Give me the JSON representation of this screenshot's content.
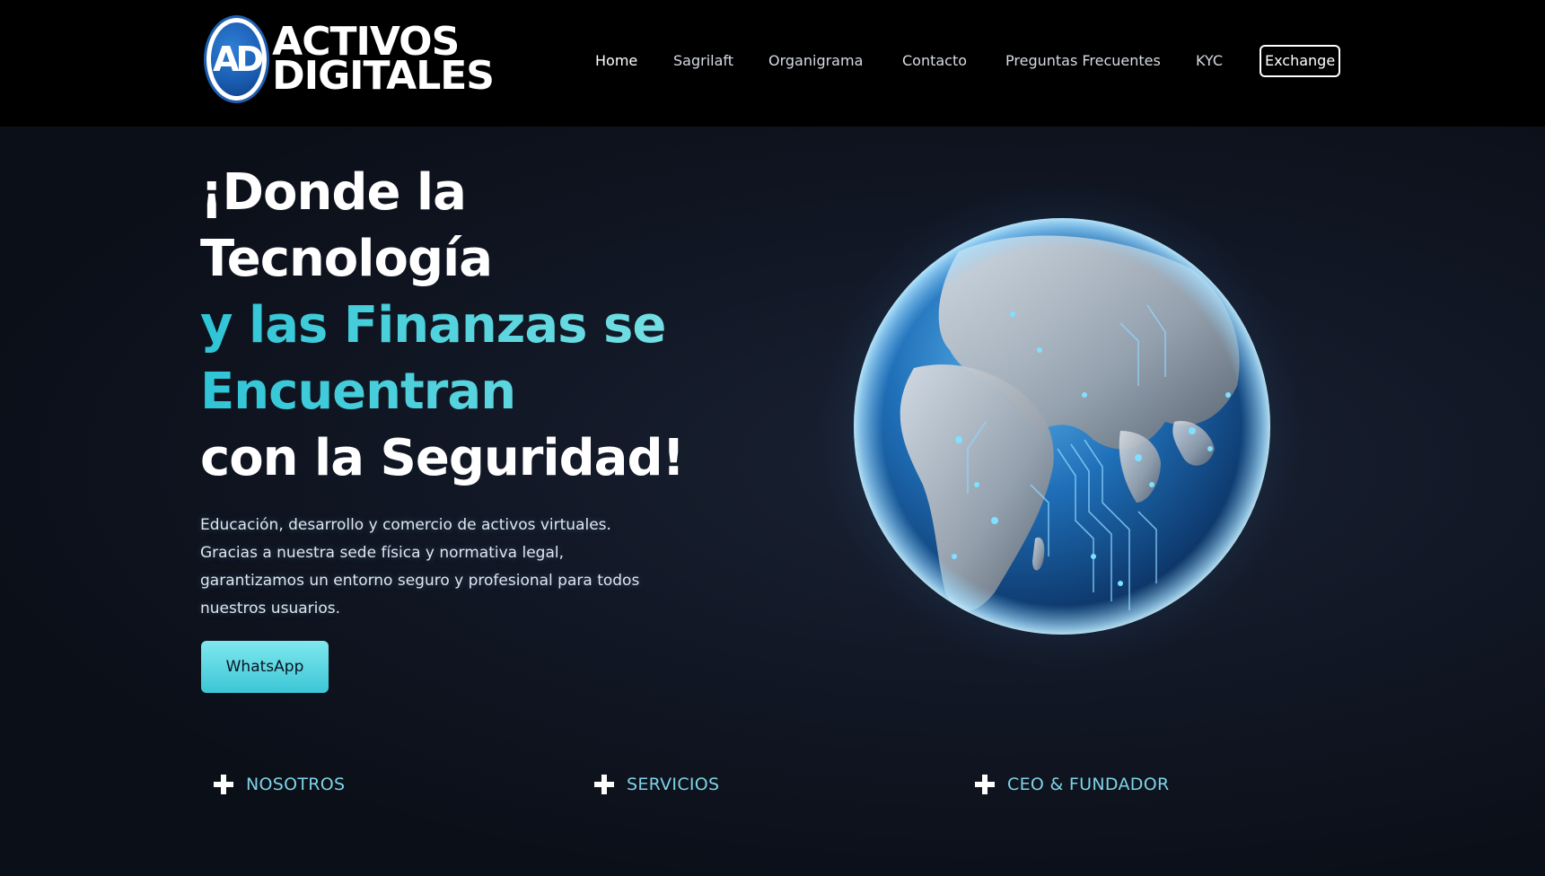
{
  "header": {
    "logo": {
      "badge_text": "AD",
      "line1": "ACTIVOS",
      "line2": "DIGITALES"
    },
    "nav": {
      "items": [
        {
          "label": "Home",
          "active": true
        },
        {
          "label": "Sagrilaft",
          "active": false
        },
        {
          "label": "Organigrama",
          "active": false
        },
        {
          "label": "Contacto",
          "active": false
        },
        {
          "label": "Preguntas Frecuentes",
          "active": false
        },
        {
          "label": "KYC",
          "active": false
        }
      ],
      "exchange_label": "Exchange"
    }
  },
  "hero": {
    "headline": {
      "line1": "¡Donde la",
      "line2": "Tecnología",
      "line3": "y las Finanzas se",
      "line4": "Encuentran",
      "line5": "con la Seguridad!"
    },
    "description": "Educación, desarrollo y comercio de activos virtuales. Gracias a nuestra sede física y normativa legal, garantizamos un entorno seguro y profesional para todos nuestros usuarios.",
    "cta_label": "WhatsApp",
    "image_icon": "circuit-globe"
  },
  "accordion": [
    {
      "label": "NOSOTROS",
      "icon": "plus-icon"
    },
    {
      "label": "SERVICIOS",
      "icon": "plus-icon"
    },
    {
      "label": "CEO & FUNDADOR",
      "icon": "plus-icon"
    }
  ],
  "colors": {
    "background": "#0b0f18",
    "header": "#000000",
    "accent": "#2ec4d6",
    "accent_light": "#7fe3e6",
    "logo_blue": "#1b5fb4"
  }
}
